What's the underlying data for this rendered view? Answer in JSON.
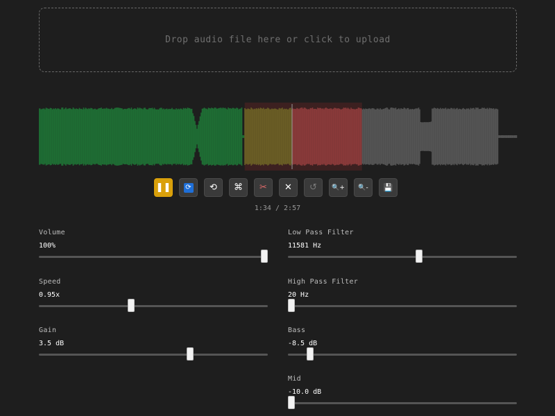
{
  "dropzone": {
    "text": "Drop audio file here or click to upload"
  },
  "waveform": {
    "progress_fraction": 0.529,
    "region_start_fraction": 0.43,
    "region_end_fraction": 0.675,
    "played_color": "#1e6e34",
    "unplayed_color": "#555555",
    "region_color": "#8a3a3a",
    "overlap_color": "#6b5e25"
  },
  "controls": [
    {
      "name": "play-pause-button",
      "icon": "pause-icon",
      "glyph": "⏸",
      "active": true
    },
    {
      "name": "loop-button",
      "icon": "loop-icon",
      "glyph": "🔁",
      "blue": true
    },
    {
      "name": "rewind-button",
      "icon": "rewind-icon",
      "glyph": "⟲"
    },
    {
      "name": "command-button",
      "icon": "command-icon",
      "glyph": "⌘"
    },
    {
      "name": "trim-button",
      "icon": "scissors-icon",
      "glyph": "✂"
    },
    {
      "name": "clear-region-button",
      "icon": "close-icon",
      "glyph": "✕"
    },
    {
      "name": "undo-button",
      "icon": "undo-icon",
      "glyph": "↺",
      "dim": true
    },
    {
      "name": "zoom-in-button",
      "icon": "zoom-in-icon",
      "glyph": "🔍+"
    },
    {
      "name": "zoom-out-button",
      "icon": "zoom-out-icon",
      "glyph": "🔍-"
    },
    {
      "name": "save-button",
      "icon": "save-icon",
      "glyph": "💾"
    }
  ],
  "time": {
    "current": "1:34",
    "separator": " / ",
    "total": "2:57"
  },
  "sliders": {
    "volume": {
      "label": "Volume",
      "value": "100%",
      "level": 1.0
    },
    "speed": {
      "label": "Speed",
      "value": "0.95x",
      "level": 0.4
    },
    "gain": {
      "label": "Gain",
      "value": "3.5 dB",
      "level": 0.667
    },
    "lowpass": {
      "label": "Low Pass Filter",
      "value": "11581 Hz",
      "level": 0.576
    },
    "highpass": {
      "label": "High Pass Filter",
      "value": "20 Hz",
      "level": 0.0
    },
    "bass": {
      "label": "Bass",
      "value": "-8.5 dB",
      "level": 0.085
    },
    "mid": {
      "label": "Mid",
      "value": "-10.0 dB",
      "level": 0.0
    }
  }
}
